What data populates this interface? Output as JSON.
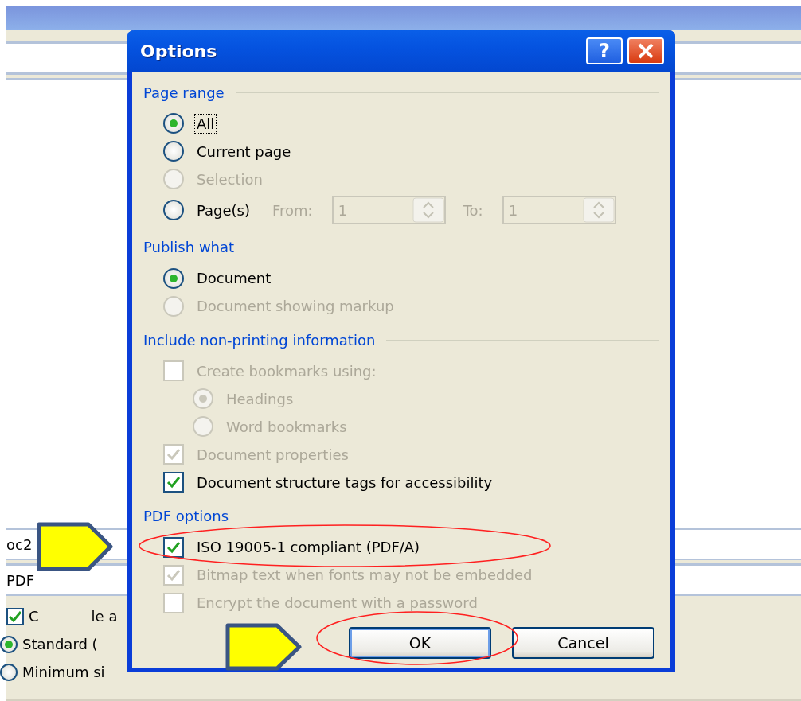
{
  "background": {
    "fields": [
      {
        "value": "oc2"
      },
      {
        "value": "PDF"
      }
    ],
    "options": [
      {
        "kind": "checkbox",
        "label_parts": [
          "C",
          "le a"
        ],
        "checked": true
      },
      {
        "kind": "radio",
        "label": "Standard (",
        "selected": true
      },
      {
        "kind": "radio",
        "label": "Minimum si",
        "selected": false
      }
    ]
  },
  "dialog": {
    "title": "Options",
    "help_glyph": "?",
    "sections": [
      {
        "heading": "Page range",
        "items": [
          {
            "kind": "radio",
            "label": "All",
            "selected": true,
            "disabled": false,
            "focused": true
          },
          {
            "kind": "radio",
            "label": "Current page",
            "selected": false,
            "disabled": false,
            "focused": false
          },
          {
            "kind": "radio",
            "label": "Selection",
            "selected": false,
            "disabled": true,
            "focused": false
          },
          {
            "kind": "range",
            "label": "Page(s)",
            "selected": false,
            "disabled": false,
            "focused": false,
            "from_label": "From:",
            "from_value": "1",
            "to_label": "To:",
            "to_value": "1"
          }
        ]
      },
      {
        "heading": "Publish what",
        "items": [
          {
            "kind": "radio",
            "label": "Document",
            "selected": true,
            "disabled": false,
            "focused": false
          },
          {
            "kind": "radio",
            "label": "Document showing markup",
            "selected": false,
            "disabled": true,
            "focused": false
          }
        ]
      },
      {
        "heading": "Include non-printing information",
        "items": [
          {
            "kind": "checkbox",
            "label": "Create bookmarks using:",
            "checked": false,
            "disabled": true,
            "focused": false,
            "children": [
              {
                "kind": "radio",
                "label": "Headings",
                "selected": true,
                "disabled": true,
                "focused": false
              },
              {
                "kind": "radio",
                "label": "Word bookmarks",
                "selected": false,
                "disabled": true,
                "focused": false
              }
            ]
          },
          {
            "kind": "checkbox",
            "label": "Document properties",
            "checked": true,
            "disabled": true,
            "focused": false
          },
          {
            "kind": "checkbox",
            "label": "Document structure tags for accessibility",
            "checked": true,
            "disabled": false,
            "focused": false
          }
        ]
      },
      {
        "heading": "PDF options",
        "items": [
          {
            "kind": "checkbox",
            "label": "ISO 19005-1 compliant (PDF/A)",
            "checked": true,
            "disabled": false,
            "focused": false
          },
          {
            "kind": "checkbox",
            "label": "Bitmap text when fonts may not be embedded",
            "checked": true,
            "disabled": true,
            "focused": false
          },
          {
            "kind": "checkbox",
            "label": "Encrypt the document with a password",
            "checked": false,
            "disabled": true,
            "focused": false
          }
        ]
      }
    ],
    "buttons": [
      {
        "label": "OK",
        "default": true
      },
      {
        "label": "Cancel",
        "default": false
      }
    ]
  }
}
